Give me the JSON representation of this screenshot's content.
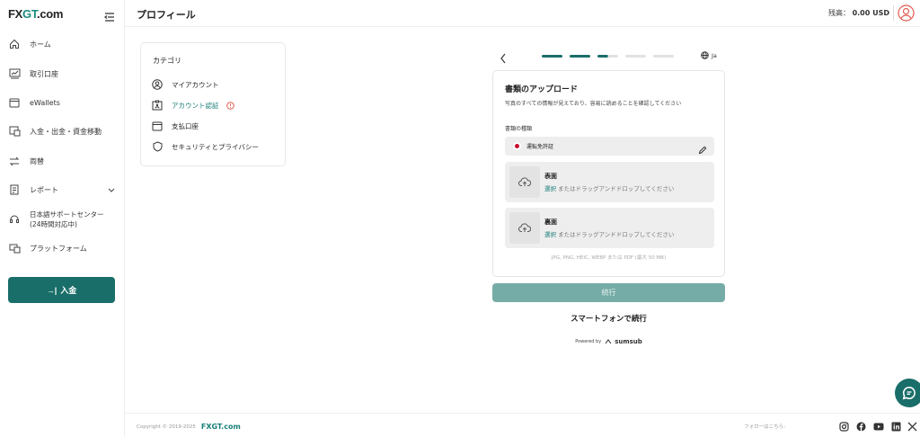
{
  "sidebar": {
    "logo": {
      "part1": "FX",
      "part2": "GT",
      "part3": ".com"
    },
    "items": [
      {
        "label": "ホーム",
        "icon": "home-icon"
      },
      {
        "label": "取引口座",
        "icon": "trading-account-icon"
      },
      {
        "label": "eWallets",
        "icon": "wallet-icon"
      },
      {
        "label": "入金・出金・資金移動",
        "icon": "transfer-icon"
      },
      {
        "label": "両替",
        "icon": "exchange-icon"
      },
      {
        "label": "レポート",
        "icon": "report-icon"
      },
      {
        "label": "日本語サポートセンター",
        "label2": "(24時間対応中)",
        "icon": "headset-icon"
      },
      {
        "label": "プラットフォーム",
        "icon": "platform-icon"
      }
    ],
    "deposit_label": "入金"
  },
  "header": {
    "title": "プロフィール",
    "balance_label": "残高：",
    "balance_value": "0.00 USD"
  },
  "category": {
    "title": "カテゴリ",
    "items": [
      {
        "label": "マイアカウント",
        "icon": "user-circle-icon"
      },
      {
        "label": "アカウント認証",
        "icon": "id-card-icon",
        "warning": true
      },
      {
        "label": "支払口座",
        "icon": "card-icon"
      },
      {
        "label": "セキュリティとプライバシー",
        "icon": "shield-icon"
      }
    ]
  },
  "verification": {
    "steps_total": 5,
    "steps_complete": 2.5,
    "language": "Ja",
    "title": "書類のアップロード",
    "description": "写真のすべての情報が見えており、容易に読めることを確認してください",
    "doc_type_label": "書類の種類",
    "doc_type_value": "運転免許証",
    "uploads": [
      {
        "title": "表面",
        "select": "選択",
        "hint": " またはドラッグアンドドロップしてください"
      },
      {
        "title": "裏面",
        "select": "選択",
        "hint": " またはドラッグアンドドロップしてください"
      }
    ],
    "formats": "JPG, PNG, HEIC, WEBP または PDF (最大 50 MB)",
    "continue_label": "続行",
    "phone_label": "スマートフォンで続行",
    "powered_by": "Powered by",
    "brand": "sumsub"
  },
  "footer": {
    "copyright": "Copyright © 2019-2025",
    "site": "FXGT.com",
    "follow": "フォローはこちら:"
  },
  "colors": {
    "accent": "#1a6e69",
    "accent_light": "#76aca7",
    "link": "#1a7f78",
    "warning": "#e05a4f"
  }
}
